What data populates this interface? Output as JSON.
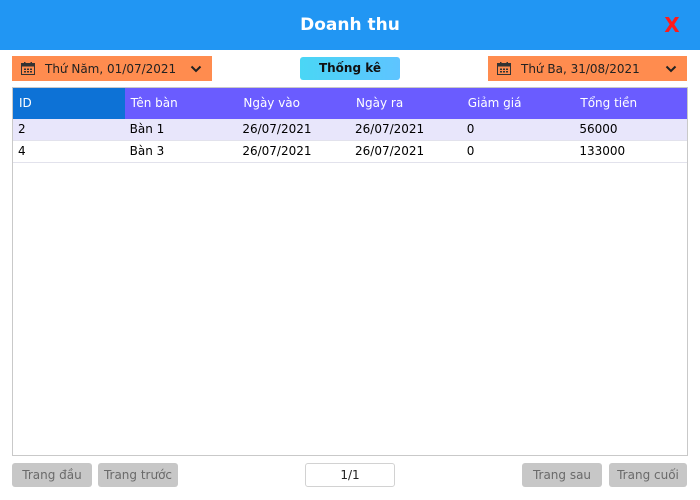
{
  "window": {
    "title": "Doanh thu",
    "close_label": "X"
  },
  "filters": {
    "from_date": "Thứ Năm, 01/07/2021",
    "to_date": "Thứ Ba, 31/08/2021",
    "stat_label": "Thống kê"
  },
  "table": {
    "columns": [
      "ID",
      "Tên bàn",
      "Ngày vào",
      "Ngày ra",
      "Giảm giá",
      "Tổng tiền"
    ],
    "rows": [
      {
        "id": "2",
        "table_name": "Bàn 1",
        "date_in": "26/07/2021",
        "date_out": "26/07/2021",
        "discount": "0",
        "total": "56000"
      },
      {
        "id": "4",
        "table_name": "Bàn 3",
        "date_in": "26/07/2021",
        "date_out": "26/07/2021",
        "discount": "0",
        "total": "133000"
      }
    ]
  },
  "pagination": {
    "first_label": "Trang đầu",
    "prev_label": "Trang trước",
    "page_info": "1/1",
    "next_label": "Trang sau",
    "last_label": "Trang cuối"
  },
  "colors": {
    "titlebar": "#2196f3",
    "date_picker": "#ff8c4f",
    "header": "#6a5cff",
    "selected_header": "#0d72d6",
    "close": "#ff1a1a"
  },
  "icons": {
    "calendar": "calendar-icon",
    "dropdown": "chevron-down-icon"
  }
}
